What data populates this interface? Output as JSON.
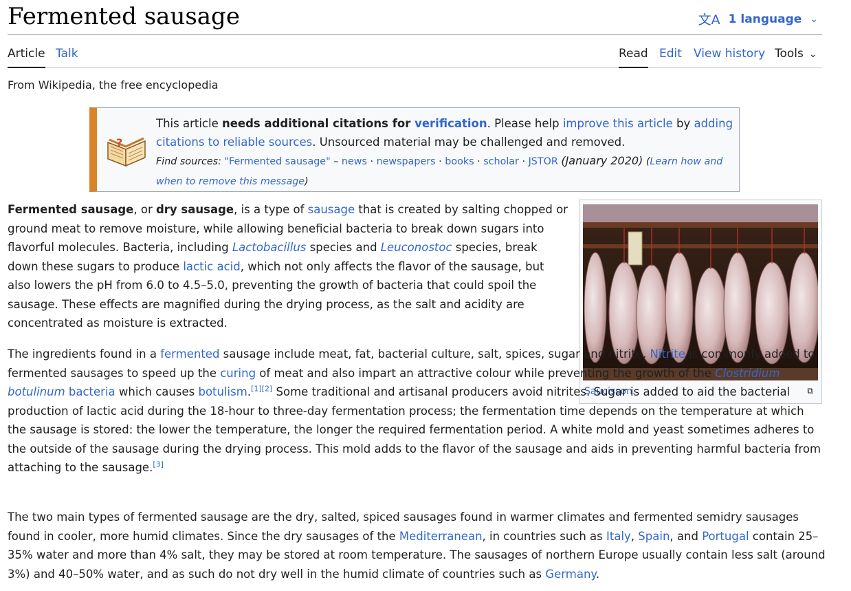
{
  "title": "Fermented sausage",
  "language_button": "1 language",
  "tabs": {
    "article": "Article",
    "talk": "Talk",
    "read": "Read",
    "edit": "Edit",
    "view_history": "View history",
    "tools": "Tools"
  },
  "tagline": "From Wikipedia, the free encyclopedia",
  "ambox": {
    "t1": "This article ",
    "t1_bold": "needs additional citations for ",
    "t1_link": "verification",
    "t2": ". Please help ",
    "link_improve": "improve this article",
    "t3": " by ",
    "link_adding": "adding citations to reliable sources",
    "t4": ". Unsourced material may be challenged and removed.",
    "find_sources": "Find sources:",
    "src_query": "\"Fermented sausage\"",
    "dash": " – ",
    "src_news": "news",
    "src_newspapers": "newspapers",
    "src_books": "books",
    "src_scholar": "scholar",
    "src_jstor": "JSTOR",
    "date": "(January 2020)",
    "learn_link": "Learn how and when to remove this message"
  },
  "thumb": {
    "caption": "Saucisson."
  },
  "p1": {
    "b1": "Fermented sausage",
    "t1": ", or ",
    "b2": "dry sausage",
    "t2": ", is a type of ",
    "l1": "sausage",
    "t3": " that is created by salting chopped or ground meat to remove moisture, while allowing beneficial bacteria to break down sugars into flavorful molecules. Bacteria, including ",
    "l2": "Lactobacillus",
    "t4": " species and ",
    "l3": "Leuconostoc",
    "t5": " species, break down these sugars to produce ",
    "l4": "lactic acid",
    "t6": ", which not only affects the flavor of the sausage, but also lowers the pH from 6.0 to 4.5–5.0, preventing the growth of bacteria that could spoil the sausage. These effects are magnified during the drying process, as the salt and acidity are concentrated as moisture is extracted."
  },
  "p2": {
    "t1": "The ingredients found in a ",
    "l1": "fermented",
    "t2": " sausage include meat, fat, bacterial culture, salt, spices, sugar and nitrite. ",
    "l2": "Nitrite",
    "t3": " is commonly added to fermented sausages to speed up the ",
    "l3": "curing",
    "t4": " of meat and also impart an attractive colour while preventing the growth of the ",
    "l4": "Clostridium botulinum",
    "l5": " bacteria",
    "t5": " which causes ",
    "l6": "botulism",
    "r1": "[1]",
    "r2": "[2]",
    "t6": " Some traditional and artisanal producers avoid nitrites. Sugar is added to aid the bacterial production of lactic acid during the 18-hour to three-day fermentation process; the fermentation time depends on the temperature at which the sausage is stored: the lower the temperature, the longer the required fermentation period. A white mold and yeast sometimes adheres to the outside of the sausage during the drying process. This mold adds to the flavor of the sausage and aids in preventing harmful bacteria from attaching to the sausage.",
    "r3": "[3]"
  },
  "p3": {
    "t1": "The two main types of fermented sausage are the dry, salted, spiced sausages found in warmer climates and fermented semidry sausages found in cooler, more humid climates. Since the dry sausages of the ",
    "l1": "Mediterranean",
    "t2": ", in countries such as ",
    "l2": "Italy",
    "t3": ", ",
    "l3": "Spain",
    "t4": ", and ",
    "l4": "Portugal",
    "t5": " contain 25–35% water and more than 4% salt, they may be stored at room temperature. The sausages of northern Europe usually contain less salt (around 3%) and 40–50% water, and as such do not dry well in the humid climate of countries such as ",
    "l5": "Germany",
    "t6": "."
  },
  "colors": {
    "link": "#3366cc",
    "ambox_stripe": "#d8822a",
    "text": "#202122"
  }
}
